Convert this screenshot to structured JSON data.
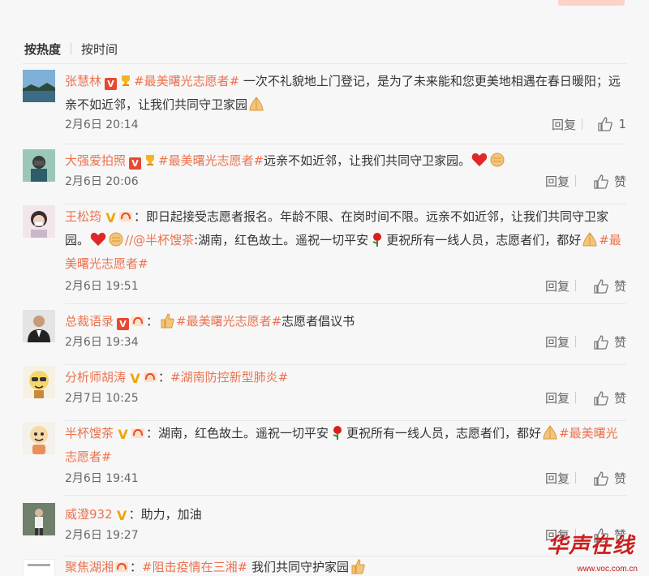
{
  "tabs": {
    "hot": "按热度",
    "time": "按时间"
  },
  "labels": {
    "reply": "回复",
    "like": "赞"
  },
  "colors": {
    "accent": "#eb7350",
    "vbadge_red": "#e8492e",
    "vbadge_gold": "#f2a405"
  },
  "comments": [
    {
      "name": "张慧林",
      "badges": [
        "v-red",
        "medal-cup"
      ],
      "text_pre": "",
      "topic": "#最美曙光志愿者#",
      "text": " 一次不礼貌地上门登记，是为了未来能和您更美地相遇在春日暖阳；远亲不如近邻，让我们共同守卫家园",
      "emoji": "praying-hands",
      "time": "2月6日 20:14",
      "like_count": "1"
    },
    {
      "name": "大强爱拍照",
      "badges": [
        "v-red",
        "medal-cup"
      ],
      "topic": "#最美曙光志愿者#",
      "text": "远亲不如近邻，让我们共同守卫家园。",
      "emoji": "heart-fist",
      "time": "2月6日 20:06",
      "like_count": "赞"
    },
    {
      "name": "王松筠",
      "badges": [
        "v-gold",
        "medal-hands"
      ],
      "text": "：即日起接受志愿者报名。年龄不限、在岗时间不限。远亲不如近邻，让我们共同守卫家园。",
      "mention": "//@半杯馊茶",
      "text2": ":湖南，红色故土。遥祝一切平安",
      "text3": "更祝所有一线人员，志愿者们，都好",
      "topic": "#最美曙光志愿者#",
      "time": "2月6日 19:51",
      "like_count": "赞"
    },
    {
      "name": "总裁语录",
      "badges": [
        "v-red",
        "medal-hands"
      ],
      "text": "：",
      "topic": "#最美曙光志愿者#",
      "text2": "志愿者倡议书",
      "time": "2月6日 19:34",
      "like_count": "赞"
    },
    {
      "name": "分析师胡涛",
      "badges": [
        "v-gold",
        "medal-hands"
      ],
      "text": "：",
      "topic": "#湖南防控新型肺炎#",
      "time": "2月7日 10:25",
      "like_count": "赞"
    },
    {
      "name": "半杯馊茶",
      "badges": [
        "v-gold",
        "medal-hands"
      ],
      "text": "：湖南，红色故土。遥祝一切平安",
      "text2": "更祝所有一线人员，志愿者们，都好",
      "topic": "#最美曙光志愿者#",
      "time": "2月6日 19:41",
      "like_count": "赞"
    },
    {
      "name": "威澄932",
      "badges": [
        "v-gold"
      ],
      "text": "：助力，加油",
      "time": "2月6日 19:27",
      "like_count": "赞"
    },
    {
      "name": "聚焦湖湘",
      "badges": [
        "medal-hands"
      ],
      "text": "：",
      "topic": "#阻击疫情在三湘#",
      "text2": " 我们共同守护家园"
    }
  ],
  "watermark": {
    "text": "华声在线",
    "url": "www.voc.com.cn"
  }
}
